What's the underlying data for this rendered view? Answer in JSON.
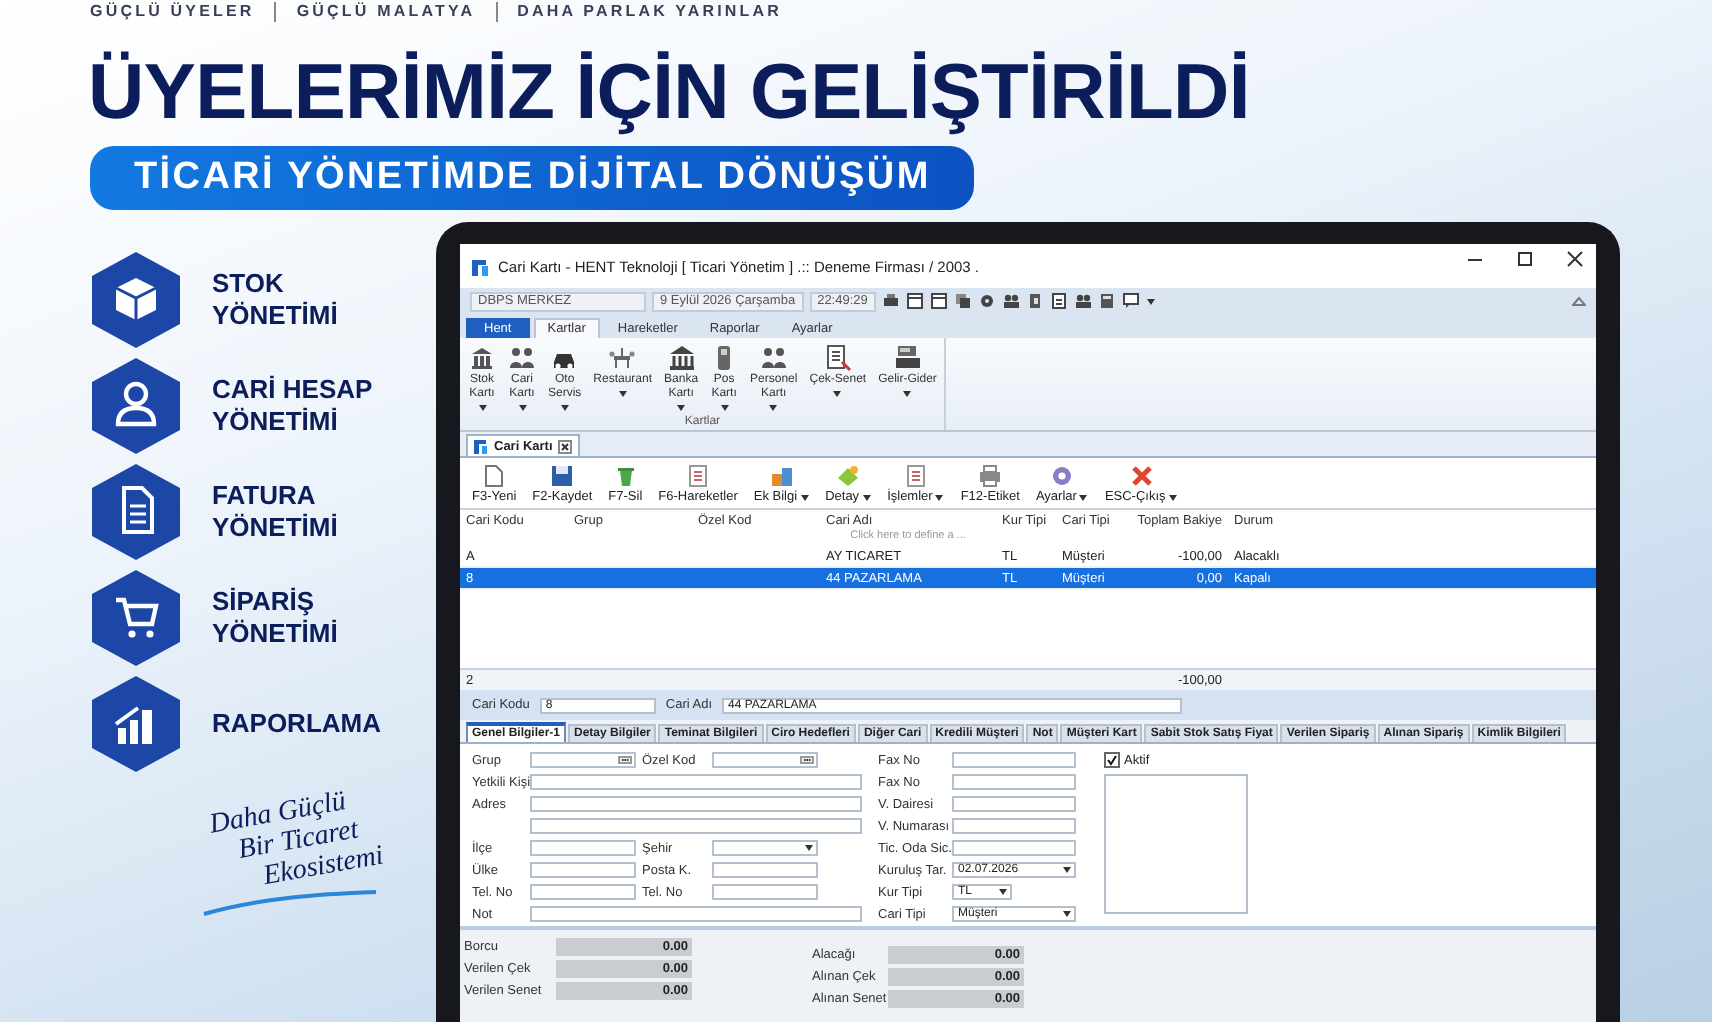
{
  "tagline": [
    "GÜÇLÜ ÜYELER",
    "GÜÇLÜ MALATYA",
    "DAHA PARLAK YARINLAR"
  ],
  "headline": "ÜYELERİMİZ İÇİN GELİŞTİRİLDİ",
  "subheadline": "TİCARİ YÖNETİMDE DİJİTAL DÖNÜŞÜM",
  "features": [
    {
      "kind": "box",
      "lines": [
        "STOK",
        "YÖNETİMİ"
      ]
    },
    {
      "kind": "person",
      "lines": [
        "CARİ HESAP",
        "YÖNETİMİ"
      ]
    },
    {
      "kind": "document",
      "lines": [
        "FATURA",
        "YÖNETİMİ"
      ]
    },
    {
      "kind": "cart",
      "lines": [
        "SİPARİŞ",
        "YÖNETİMİ"
      ]
    },
    {
      "kind": "chart",
      "lines": [
        "RAPORLAMA"
      ]
    }
  ],
  "slogan": [
    "Daha Güçlü",
    "Bir Ticaret",
    "Ekosistemi"
  ],
  "app": {
    "title": "Cari Kartı - HENT Teknoloji [ Ticari Yönetim ] .:: Deneme Firması / 2003 .",
    "status": {
      "branch": "DBPS  MERKEZ",
      "date": "9 Eylül 2026 Çarşamba",
      "time": "22:49:29"
    },
    "ribbon_tabs": [
      {
        "label": "Hent",
        "kind": "app",
        "selected": false
      },
      {
        "label": "Kartlar",
        "kind": "tab",
        "selected": true
      },
      {
        "label": "Hareketler",
        "kind": "tab",
        "selected": false
      },
      {
        "label": "Raporlar",
        "kind": "tab",
        "selected": false
      },
      {
        "label": "Ayarlar",
        "kind": "tab",
        "selected": false
      }
    ],
    "ribbon_buttons": [
      {
        "lines": [
          "Stok",
          "Kartı"
        ],
        "dropdown": true
      },
      {
        "lines": [
          "Cari",
          "Kartı"
        ],
        "dropdown": true
      },
      {
        "lines": [
          "Oto",
          "Servis"
        ],
        "dropdown": true
      },
      {
        "lines": [
          "Restaurant"
        ],
        "dropdown": true
      },
      {
        "lines": [
          "Banka",
          "Kartı"
        ],
        "dropdown": true
      },
      {
        "lines": [
          "Pos",
          "Kartı"
        ],
        "dropdown": true
      },
      {
        "lines": [
          "Personel",
          "Kartı"
        ],
        "dropdown": true
      },
      {
        "lines": [
          "Çek-Senet"
        ],
        "dropdown": true
      },
      {
        "lines": [
          "Gelir-Gider"
        ],
        "dropdown": true
      }
    ],
    "ribbon_group": "Kartlar",
    "doc_tab": "Cari Kartı",
    "toolbar": [
      {
        "label": "F3-Yeni",
        "dropdown": false
      },
      {
        "label": "F2-Kaydet",
        "dropdown": false
      },
      {
        "label": "F7-Sil",
        "dropdown": false
      },
      {
        "label": "F6-Hareketler",
        "dropdown": false
      },
      {
        "label": "Ek Bilgi",
        "dropdown": true
      },
      {
        "label": "Detay",
        "dropdown": true
      },
      {
        "label": "İşlemler",
        "dropdown": true
      },
      {
        "label": "F12-Etiket",
        "dropdown": false
      },
      {
        "label": "Ayarlar",
        "dropdown": true
      },
      {
        "label": "ESC-Çıkış",
        "dropdown": true
      }
    ],
    "grid": {
      "columns": [
        "Cari Kodu",
        "Grup",
        "Özel Kod",
        "Cari Adı",
        "Kur Tipi",
        "Cari Tipi",
        "Toplam Bakiye",
        "Durum"
      ],
      "filter_hint": "Click here to define a ...",
      "rows": [
        {
          "cells": [
            "A",
            null,
            null,
            "AY TICARET",
            "TL",
            "Müşteri",
            "-100,00",
            "Alacaklı"
          ],
          "selected": false
        },
        {
          "cells": [
            "8",
            null,
            null,
            "44 PAZARLAMA",
            "TL",
            "Müşteri",
            "0,00",
            "Kapalı"
          ],
          "selected": true
        }
      ],
      "footer_count": "2",
      "footer_total": "-100,00"
    },
    "record": {
      "code_label": "Cari Kodu",
      "code": "8",
      "name_label": "Cari Adı",
      "name": "44 PAZARLAMA"
    },
    "detail_tabs": [
      {
        "label": "Genel Bilgiler-1",
        "selected": true
      },
      {
        "label": "Detay Bilgiler",
        "selected": false
      },
      {
        "label": "Teminat Bilgileri",
        "selected": false
      },
      {
        "label": "Ciro Hedefleri",
        "selected": false
      },
      {
        "label": "Diğer Cari",
        "selected": false
      },
      {
        "label": "Kredili Müşteri",
        "selected": false
      },
      {
        "label": "Not",
        "selected": false
      },
      {
        "label": "Müşteri Kart",
        "selected": false
      },
      {
        "label": "Sabit Stok Satış Fiyat",
        "selected": false
      },
      {
        "label": "Verilen Sipariş",
        "selected": false
      },
      {
        "label": "Alınan Sipariş",
        "selected": false
      },
      {
        "label": "Kimlik Bilgileri",
        "selected": false
      }
    ],
    "form_left": [
      [
        {
          "label": "Grup",
          "kind": "lookup"
        },
        {
          "label": "Özel Kod",
          "kind": "lookup"
        }
      ],
      [
        {
          "label": "Yetkili Kişi",
          "kind": "text"
        }
      ],
      [
        {
          "label": "Adres",
          "kind": "text"
        }
      ],
      [
        {
          "kind": "text"
        }
      ],
      [
        {
          "label": "İlçe",
          "kind": "text"
        },
        {
          "label": "Şehir",
          "kind": "combo"
        }
      ],
      [
        {
          "label": "Ülke",
          "kind": "text"
        },
        {
          "label": "Posta K.",
          "kind": "text"
        }
      ],
      [
        {
          "label": "Tel. No",
          "kind": "text"
        },
        {
          "label": "Tel. No",
          "kind": "text"
        }
      ],
      [
        {
          "label": "Not",
          "kind": "text"
        }
      ]
    ],
    "form_middle": [
      {
        "label": "Fax No",
        "kind": "text"
      },
      {
        "label": "Fax No",
        "kind": "text"
      },
      {
        "label": "V. Dairesi",
        "kind": "text"
      },
      {
        "label": "V. Numarası",
        "kind": "text"
      },
      {
        "label": "Tic. Oda Sic.",
        "kind": "text"
      },
      {
        "label": "Kuruluş Tar.",
        "kind": "combo",
        "value": "02.07.2026"
      },
      {
        "label": "Kur Tipi",
        "kind": "combo",
        "value": "TL"
      },
      {
        "label": "Cari Tipi",
        "kind": "combo",
        "value": "Müşteri"
      }
    ],
    "active": {
      "label": "Aktif",
      "checked": true
    },
    "totals_left": [
      {
        "label": "Borcu",
        "value": "0.00"
      },
      {
        "label": "Verilen Çek",
        "value": "0.00"
      },
      {
        "label": "Verilen Senet",
        "value": "0.00"
      }
    ],
    "totals_right": [
      {
        "label": "Alacağı",
        "value": "0.00"
      },
      {
        "label": "Alınan Çek",
        "value": "0.00"
      },
      {
        "label": "Alınan Senet",
        "value": "0.00"
      }
    ]
  }
}
